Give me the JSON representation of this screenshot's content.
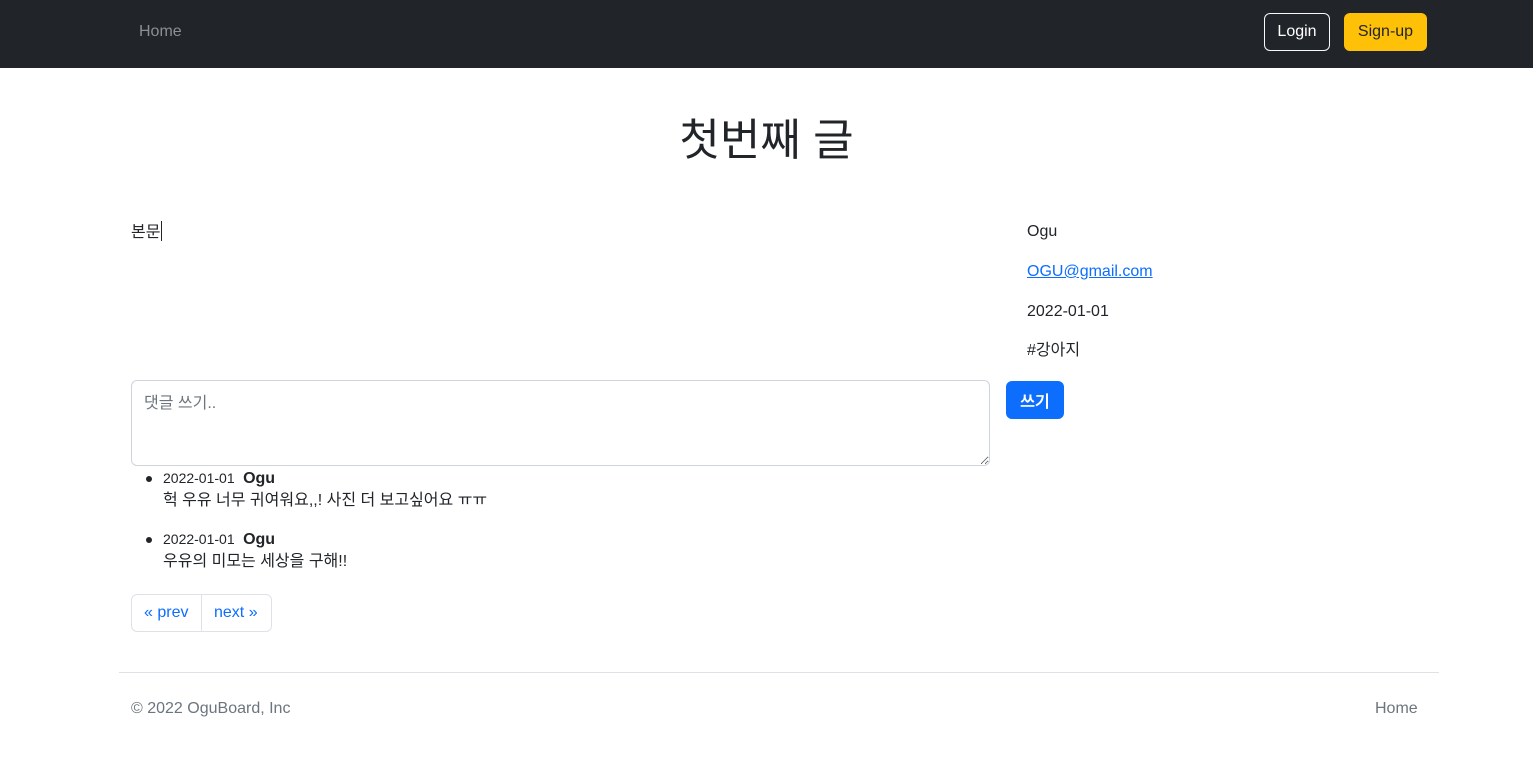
{
  "nav": {
    "home": "Home",
    "login": "Login",
    "signup": "Sign-up"
  },
  "post": {
    "title": "첫번째 글",
    "body": "본문",
    "author": "Ogu",
    "email": "OGU@gmail.com",
    "date": "2022-01-01",
    "hashtag": "#강아지"
  },
  "comment_form": {
    "placeholder": "댓글 쓰기..",
    "submit": "쓰기"
  },
  "comments": [
    {
      "date": "2022-01-01",
      "author": "Ogu",
      "text": "헉 우유 너무 귀여워요,,! 사진 더 보고싶어요 ㅠㅠ"
    },
    {
      "date": "2022-01-01",
      "author": "Ogu",
      "text": "우유의 미모는 세상을 구해!!"
    }
  ],
  "pagination": {
    "prev": "« prev",
    "next": "next »"
  },
  "footer": {
    "copyright": "© 2022 OguBoard, Inc",
    "home": "Home"
  },
  "colors": {
    "navbar": "#212529",
    "signup": "#ffc107",
    "primary": "#0d6efd"
  }
}
